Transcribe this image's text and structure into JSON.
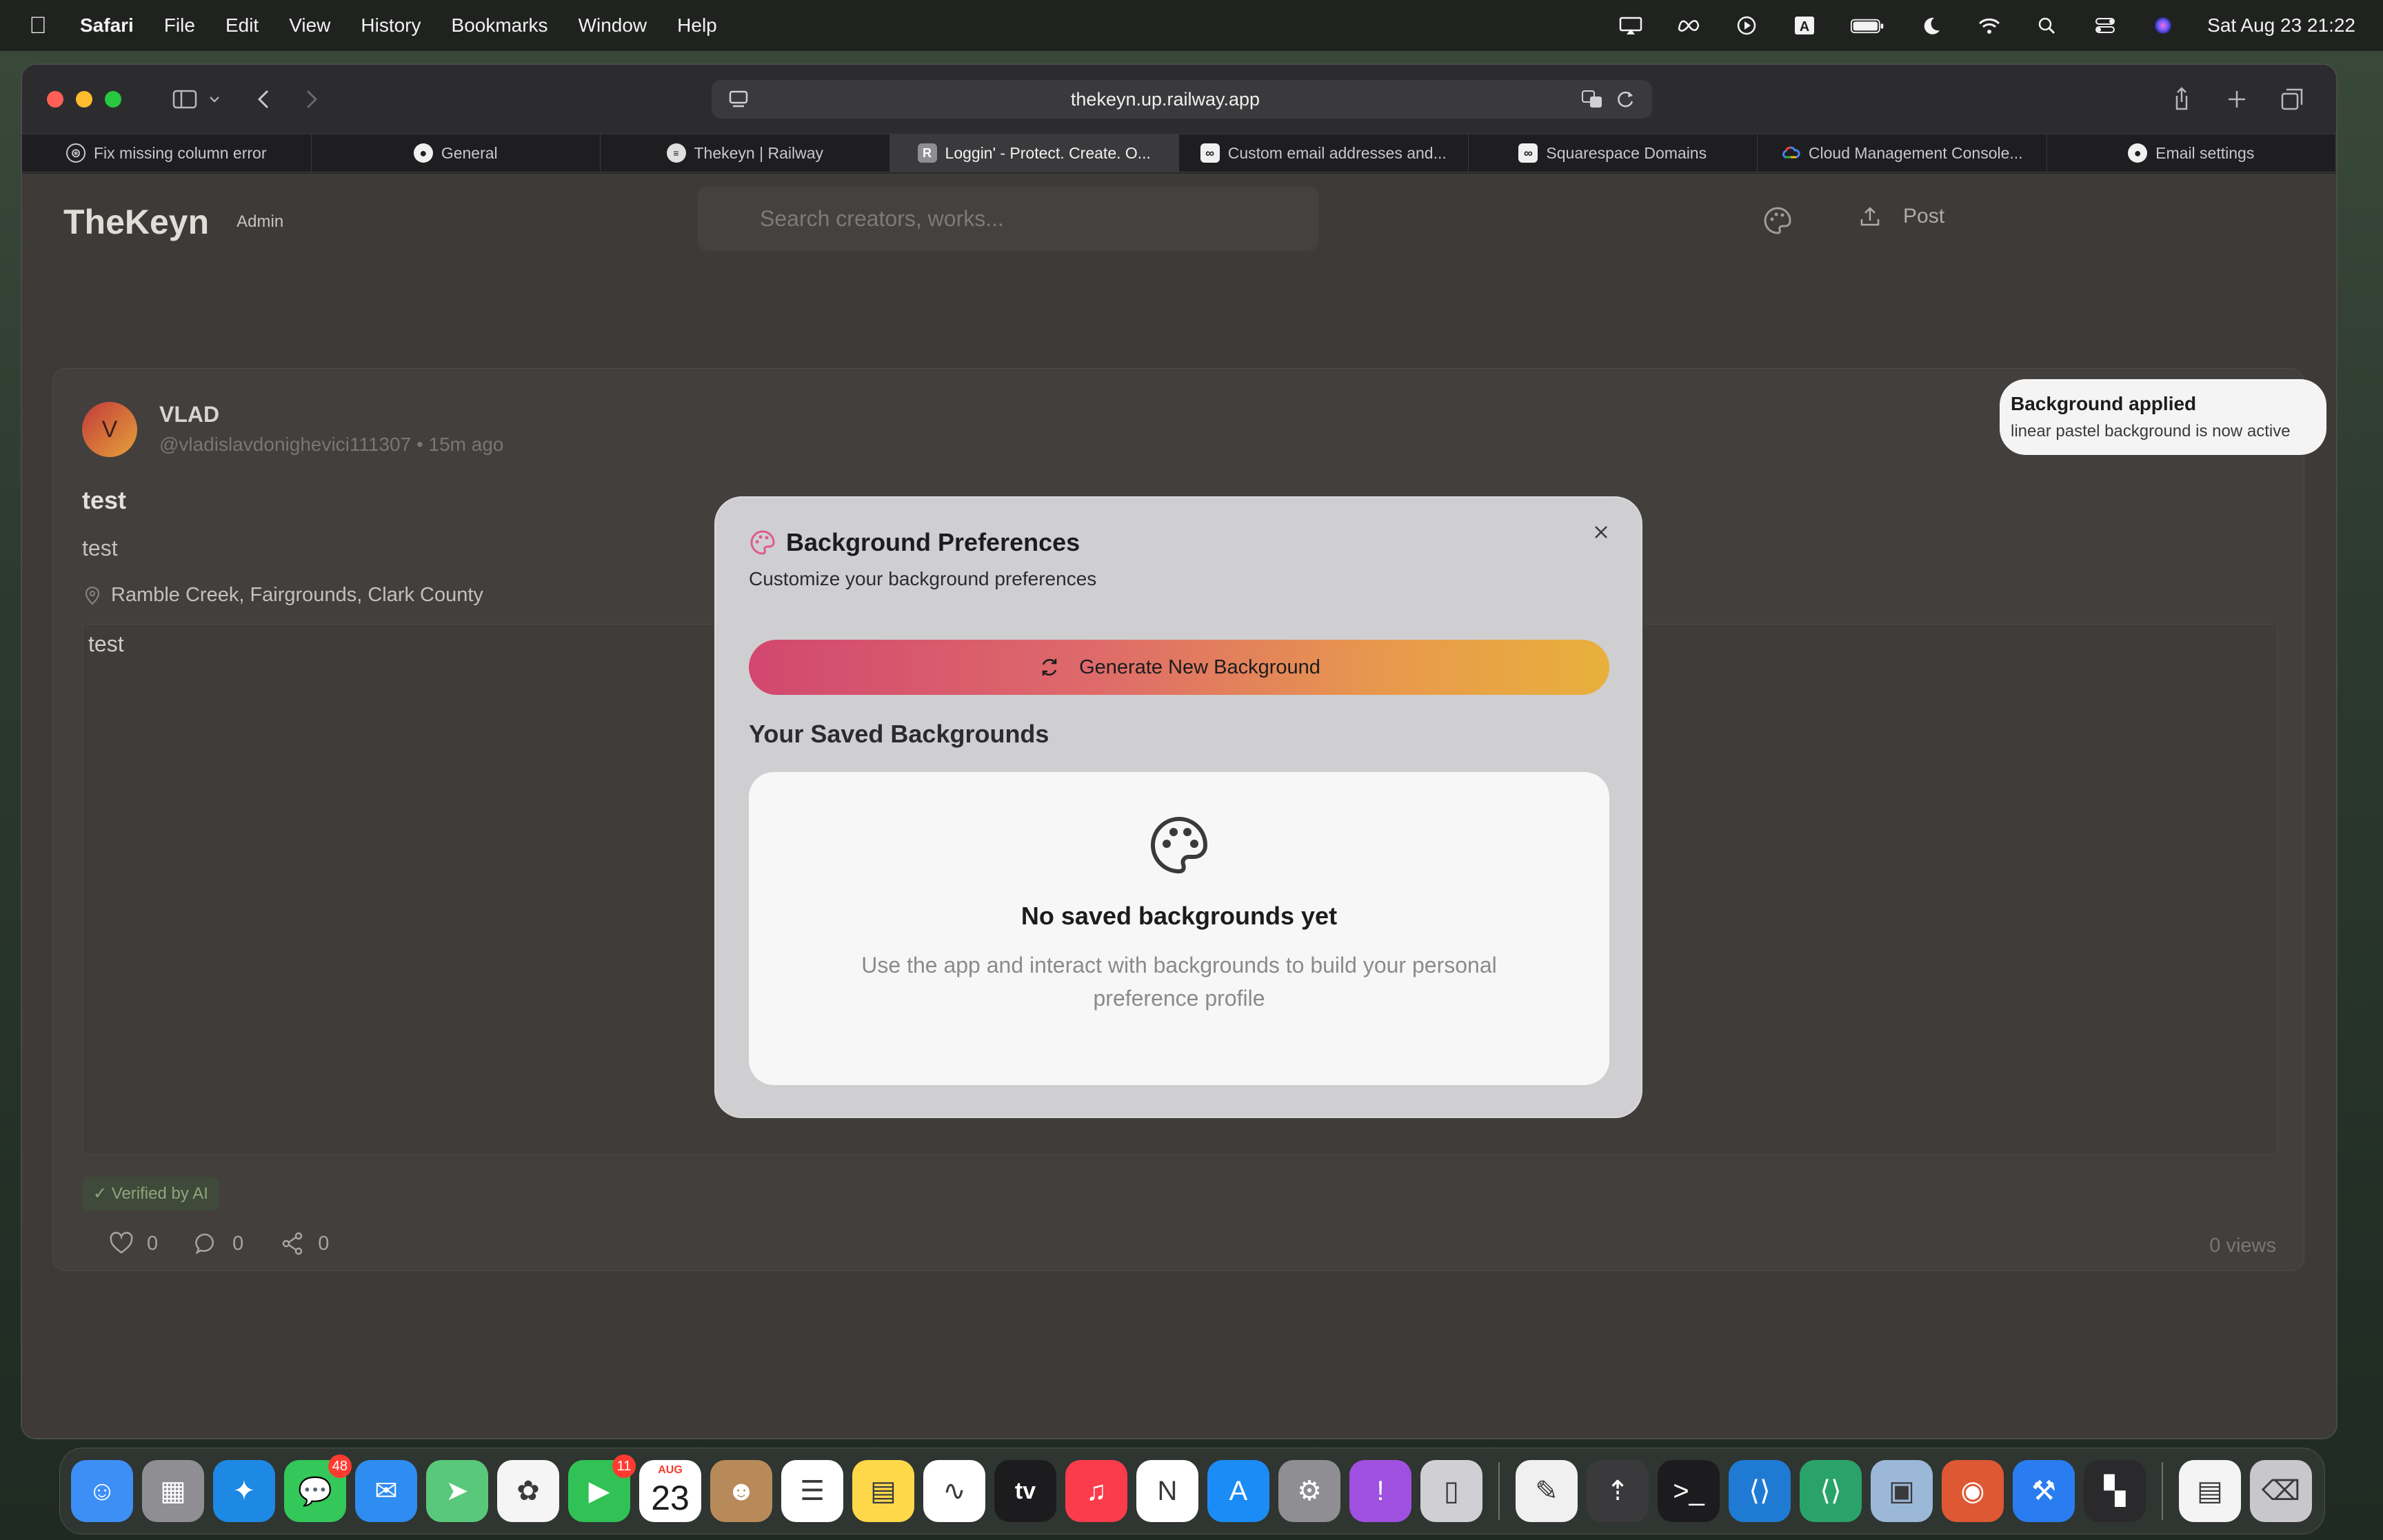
{
  "menubar": {
    "app_name": "Safari",
    "items": [
      "File",
      "Edit",
      "View",
      "History",
      "Bookmarks",
      "Window",
      "Help"
    ],
    "input_source": "A",
    "clock": "Sat Aug 23  21:22"
  },
  "browser": {
    "url": "thekeyn.up.railway.app",
    "tabs": [
      {
        "label": "Fix missing column error",
        "icon": "openai-icon",
        "active": false
      },
      {
        "label": "General",
        "icon": "github-icon",
        "active": false
      },
      {
        "label": "Thekeyn | Railway",
        "icon": "railway-icon",
        "active": false
      },
      {
        "label": "Loggin' - Protect. Create. O...",
        "icon": "r-icon",
        "icon_text": "R",
        "active": true
      },
      {
        "label": "Custom email addresses and...",
        "icon": "squarespace-icon",
        "active": false
      },
      {
        "label": "Squarespace Domains",
        "icon": "squarespace-icon",
        "active": false
      },
      {
        "label": "Cloud Management Console...",
        "icon": "cloud-icon",
        "active": false
      },
      {
        "label": "Email settings",
        "icon": "github-icon",
        "active": false
      }
    ]
  },
  "site": {
    "logo": "TheKeyn",
    "admin_badge": "Admin",
    "search_placeholder": "Search creators, works...",
    "post_button": "Post"
  },
  "post": {
    "avatar_letter": "V",
    "author_name": "VLAD",
    "author_meta": "@vladislavdonighevici111307 • 15m ago",
    "more": "•••",
    "title": "test",
    "body": "test",
    "location": "Ramble Creek, Fairgrounds, Clark County",
    "media_text": "test",
    "verified": "✓ Verified by AI",
    "likes": "0",
    "comments": "0",
    "shares": "0",
    "views": "0 views"
  },
  "toast": {
    "title": "Background applied",
    "description": "linear pastel background is now active"
  },
  "modal": {
    "title": "Background Preferences",
    "subtitle": "Customize your background preferences",
    "generate_button": "Generate New Background",
    "saved_heading": "Your Saved Backgrounds",
    "empty_title": "No saved backgrounds yet",
    "empty_description": "Use the app and interact with backgrounds to build your personal preference profile",
    "accent_gradient": [
      "#d2476f",
      "#e8b03c"
    ]
  },
  "dock": {
    "apps": [
      {
        "name": "finder-icon",
        "color": "#3d8ff5"
      },
      {
        "name": "launchpad-icon",
        "color": "#8e8e93"
      },
      {
        "name": "safari-icon",
        "color": "#1e88e5"
      },
      {
        "name": "messages-icon",
        "color": "#34c759",
        "badge": "48"
      },
      {
        "name": "mail-icon",
        "color": "#2f8cf0"
      },
      {
        "name": "maps-icon",
        "color": "#5ac87a"
      },
      {
        "name": "photos-icon",
        "color": "#f5f5f5"
      },
      {
        "name": "facetime-icon",
        "color": "#30c254",
        "badge": "11"
      },
      {
        "name": "calendar-icon",
        "color": "#ffffff",
        "month": "AUG",
        "day": "23"
      },
      {
        "name": "contacts-icon",
        "color": "#b88a5a"
      },
      {
        "name": "reminders-icon",
        "color": "#ffffff"
      },
      {
        "name": "notes-icon",
        "color": "#ffd84a"
      },
      {
        "name": "freeform-icon",
        "color": "#ffffff"
      },
      {
        "name": "apple-tv-icon",
        "color": "#1c1c1e",
        "label": "tv"
      },
      {
        "name": "music-icon",
        "color": "#fa3c4c"
      },
      {
        "name": "news-icon",
        "color": "#ffffff"
      },
      {
        "name": "app-store-icon",
        "color": "#1b8cf5"
      },
      {
        "name": "system-settings-icon",
        "color": "#8e8e93"
      },
      {
        "name": "feedback-icon",
        "color": "#a050e0"
      },
      {
        "name": "iphone-mirroring-icon",
        "color": "#d0d0d4"
      },
      {
        "name": "separator",
        "color": ""
      },
      {
        "name": "textedit-icon",
        "color": "#f0f0f0"
      },
      {
        "name": "rocket-icon",
        "color": "#3a3a3c"
      },
      {
        "name": "terminal-icon",
        "color": "#1c1c1e"
      },
      {
        "name": "vscode-icon",
        "color": "#1f7ad4"
      },
      {
        "name": "vscode-insiders-icon",
        "color": "#2aa36a"
      },
      {
        "name": "preview-icon",
        "color": "#9bb8d8"
      },
      {
        "name": "duckduckgo-icon",
        "color": "#de5833"
      },
      {
        "name": "xcode-icon",
        "color": "#2a7df0"
      },
      {
        "name": "tableplus-icon",
        "color": "#2a2a2c"
      },
      {
        "name": "separator",
        "color": ""
      },
      {
        "name": "document-icon",
        "color": "#f4f4f4"
      },
      {
        "name": "trash-icon",
        "color": "#c8c8cc"
      }
    ]
  }
}
